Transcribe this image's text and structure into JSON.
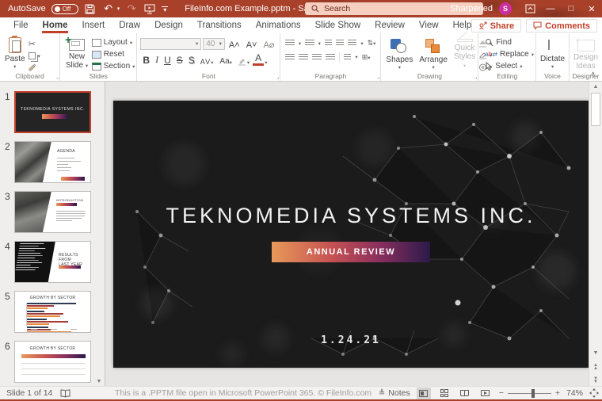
{
  "titlebar": {
    "autosave_label": "AutoSave",
    "autosave_state": "Off",
    "filename": "FileInfo.com Example.pptm  -  Saved to this PC",
    "search_placeholder": "Search",
    "user_name": "Sharpened",
    "user_initial": "S",
    "minimize": "—",
    "maximize": "□",
    "close": "✕"
  },
  "tabs": {
    "items": [
      "File",
      "Home",
      "Insert",
      "Draw",
      "Design",
      "Transitions",
      "Animations",
      "Slide Show",
      "Review",
      "View",
      "Help"
    ],
    "active": "Home",
    "share_label": "Share",
    "comments_label": "Comments"
  },
  "ribbon": {
    "clipboard": {
      "label": "Clipboard",
      "paste": "Paste"
    },
    "slides": {
      "label": "Slides",
      "new_slide_1": "New",
      "new_slide_2": "Slide",
      "layout": "Layout",
      "reset": "Reset",
      "section": "Section"
    },
    "font": {
      "label": "Font",
      "size_value": "40",
      "buttons": {
        "bold": "B",
        "italic": "I",
        "underline": "U",
        "strike": "S",
        "shadow": "S",
        "spacing": "AV",
        "case": "Aa",
        "grow": "A˄",
        "shrink": "A˅",
        "clear": "A⌀",
        "highlight": "A",
        "color": "A"
      }
    },
    "paragraph": {
      "label": "Paragraph"
    },
    "drawing": {
      "label": "Drawing",
      "shapes": "Shapes",
      "arrange": "Arrange",
      "quick_styles_1": "Quick",
      "quick_styles_2": "Styles"
    },
    "editing": {
      "label": "Editing",
      "find": "Find",
      "replace": "Replace",
      "select": "Select"
    },
    "voice": {
      "label": "Voice",
      "dictate": "Dictate"
    },
    "designer": {
      "label": "Designer",
      "design_ideas_1": "Design",
      "design_ideas_2": "Ideas"
    }
  },
  "thumbnails": {
    "0": {
      "number": "1",
      "title": "TEKNOMEDIA SYSTEMS INC."
    },
    "1": {
      "number": "2",
      "title": "AGENDA"
    },
    "2": {
      "number": "3",
      "title": "INTRODUCTION"
    },
    "3": {
      "number": "4",
      "title_1": "RESULTS FROM",
      "title_2": "LAST YEAR"
    },
    "4": {
      "number": "5",
      "title": "GROWTH BY SECTOR"
    },
    "5": {
      "number": "6",
      "title": "GROWTH BY SECTOR"
    }
  },
  "slide": {
    "title": "TEKNOMEDIA SYSTEMS INC.",
    "banner": "ANNUAL REVIEW",
    "date": "1.24.21"
  },
  "statusbar": {
    "slide_indicator": "Slide 1 of 14",
    "message": "This is a .PPTM file open in Microsoft PowerPoint 365. © FileInfo.com",
    "notes_label": "Notes",
    "zoom_level": "74%"
  },
  "colors": {
    "titlebar": "#A8402A",
    "accent": "#C2402A",
    "avatar": "#CE2F9F",
    "dictate_blue": "#2B7CD3",
    "banner_gradient": [
      "#E8995A",
      "#C65152",
      "#8A2F5E",
      "#2A1A4A"
    ],
    "slide_background": "#1B1B1B"
  }
}
